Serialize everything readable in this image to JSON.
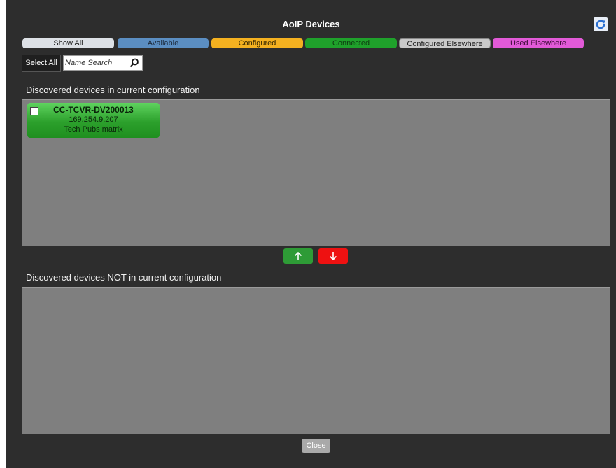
{
  "dialog": {
    "title": "AoIP Devices"
  },
  "filters": [
    {
      "label": "Show All",
      "color": "#dde1e6"
    },
    {
      "label": "Available",
      "color": "#5b8ec2"
    },
    {
      "label": "Configured",
      "color": "#f4b120"
    },
    {
      "label": "Connected",
      "color": "#1fa12b"
    },
    {
      "label": "Configured Elsewhere",
      "color": "#c9c9c9"
    },
    {
      "label": "Used Elsewhere",
      "color": "#e25ad8"
    }
  ],
  "toolbar": {
    "select_all_label": "Select All",
    "search_placeholder": "Name Search"
  },
  "sections": {
    "in_config_label": "Discovered devices in current configuration",
    "not_in_config_label": "Discovered devices NOT in current configuration"
  },
  "devices_in_config": [
    {
      "name": "CC-TCVR-DV200013",
      "ip": "169.254.9.207",
      "location": "Tech Pubs matrix",
      "status_color": "#2ca02c",
      "checked": false
    }
  ],
  "devices_not_in_config": [],
  "buttons": {
    "close_label": "Close"
  },
  "icons": {
    "refresh": "refresh-icon",
    "search": "search-icon",
    "move_up": "arrow-up-icon",
    "move_down": "arrow-down-icon"
  }
}
